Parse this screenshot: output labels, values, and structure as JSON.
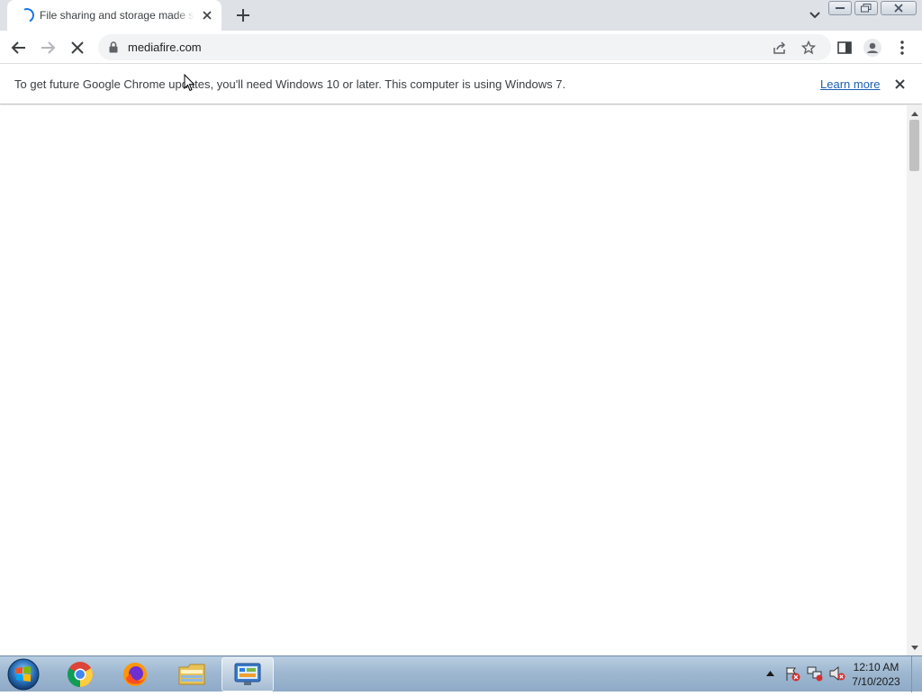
{
  "browser": {
    "tab": {
      "title": "File sharing and storage made simple",
      "loading": true
    },
    "url": "mediafire.com",
    "infobar": {
      "message": "To get future Google Chrome updates, you'll need Windows 10 or later. This computer is using Windows 7.",
      "link_label": "Learn more"
    },
    "colors": {
      "tabstrip_bg": "#dee1e6",
      "omnibox_bg": "#f1f3f4",
      "accent": "#1a73e8",
      "link": "#1a5fb4"
    }
  },
  "taskbar": {
    "items": [
      "start-orb",
      "chrome-icon",
      "firefox-icon",
      "file-explorer-icon",
      "control-panel-icon"
    ],
    "active_item": "control-panel-icon",
    "clock": {
      "time": "12:10 AM",
      "date": "7/10/2023"
    }
  }
}
